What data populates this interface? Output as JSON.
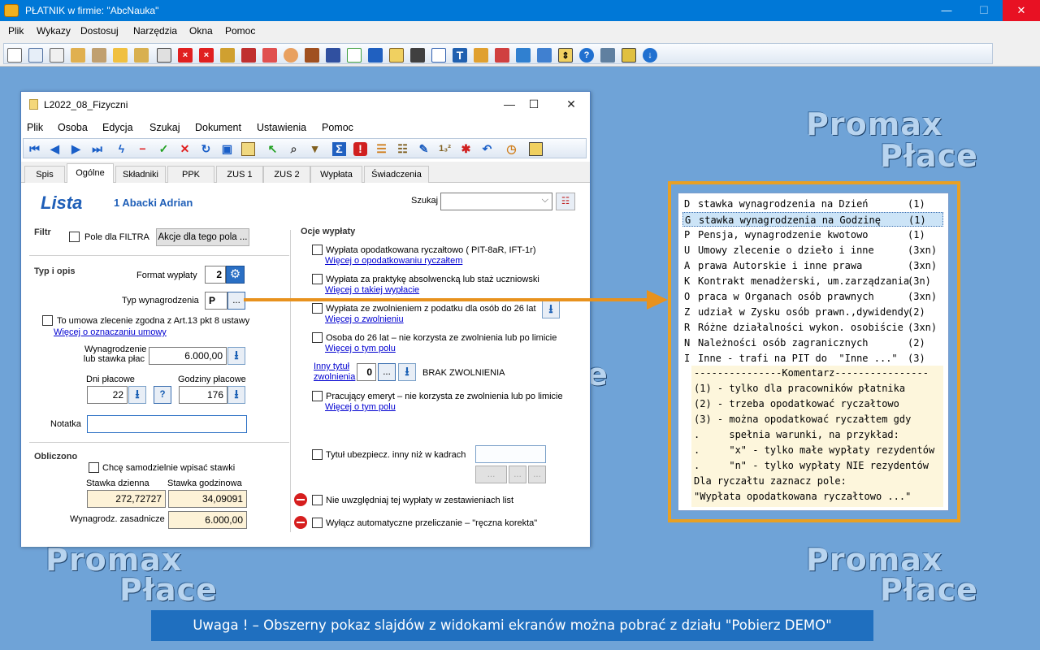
{
  "app": {
    "title": "PŁATNIK  w firmie:  \"AbcNauka\"",
    "menu": [
      "Plik",
      "Wykazy",
      "Dostosuj",
      "Narzędzia",
      "Okna",
      "Pomoc"
    ]
  },
  "watermark": {
    "line1": "Promax",
    "line2": "Płace",
    "partial": "e"
  },
  "child": {
    "title": "L2022_08_Fizyczni",
    "menu": [
      "Plik",
      "Osoba",
      "Edycja",
      "Szukaj",
      "Dokument",
      "Ustawienia",
      "Pomoc"
    ],
    "tabs": [
      "Spis",
      "Ogólne",
      "Składniki",
      "PPK",
      "ZUS 1",
      "ZUS 2",
      "Wypłata",
      "Świadczenia"
    ],
    "active_tab": "Ogólne"
  },
  "form": {
    "lista_label": "Lista",
    "employee": "1 Abacki Adrian",
    "szukaj_label": "Szukaj",
    "filtr_label": "Filtr",
    "pole_filtra_label": "Pole dla FILTRA",
    "akcje_button": "Akcje dla tego pola ...",
    "typ_i_opis_label": "Typ i opis",
    "format_wyplaty_label": "Format wypłaty",
    "format_wyplaty_value": "2",
    "typ_wynagrodzenia_label": "Typ wynagrodzenia",
    "typ_wynagrodzenia_value": "P",
    "ellipsis": "...",
    "umowa_label": "To umowa zlecenie zgodna z Art.13 pkt 8 ustawy",
    "umowa_link": "Więcej o oznaczaniu umowy",
    "wynagrodzenie_label_1": "Wynagrodzenie",
    "wynagrodzenie_label_2": "lub stawka płac",
    "wynagrodzenie_value": "6.000,00",
    "dni_label": "Dni płacowe",
    "dni_value": "22",
    "godziny_label": "Godziny płacowe",
    "godziny_value": "176",
    "help_glyph": "?",
    "notatka_label": "Notatka",
    "notatka_value": "",
    "obliczono_label": "Obliczono",
    "samodzielnie_label": "Chcę samodzielnie wpisać stawki",
    "stawka_dzienna_label": "Stawka dzienna",
    "stawka_dzienna_value": "272,72727",
    "stawka_godzinowa_label": "Stawka godzinowa",
    "stawka_godzinowa_value": "34,09091",
    "wynagrodz_zasadnicze_label": "Wynagrodz. zasadnicze",
    "wynagrodz_zasadnicze_value": "6.000,00",
    "opcje_label": "Ocje wypłaty",
    "opt1_label": "Wypłata opodatkowana ryczałtowo  ( PIT-8aR, IFT-1r)",
    "opt1_link": "Więcej o opodatkowaniu ryczałtem",
    "opt2_label": "Wypłata za praktykę absolwencką lub staż uczniowski",
    "opt2_link": "Więcej o takiej wypłacie",
    "opt3_label": "Wypłata ze zwolnieniem z podatku dla osób do 26 lat",
    "opt3_link": "Więcej o zwolnieniu",
    "opt4_label": "Osoba do 26 lat – nie korzysta ze zwolnienia lub po limicie",
    "opt4_link": "Więcej o tym polu",
    "inny_tytul_link_1": "Inny tytuł",
    "inny_tytul_link_2": "zwolnienia",
    "inny_tytul_value": "0",
    "brak_zwolnienia": "BRAK  ZWOLNIENIA",
    "opt5_label": "Pracujący emeryt – nie korzysta ze zwolnienia lub po limicie",
    "opt5_link": "Więcej o tym polu",
    "opt6_label": "Tytuł ubezpiecz. inny niż w kadrach",
    "opt7_label": "Nie uwzględniaj tej wypłaty w zestawieniach list",
    "opt8_label": "Wyłącz automatyczne przeliczanie  – \"ręczna korekta\""
  },
  "popup": {
    "items": [
      {
        "code": "D",
        "desc": "stawka wynagrodzenia na Dzień",
        "grp": "(1)"
      },
      {
        "code": "G",
        "desc": "stawka wynagrodzenia na Godzinę",
        "grp": "(1)"
      },
      {
        "code": "P",
        "desc": "Pensja, wynagrodzenie kwotowo",
        "grp": "(1)"
      },
      {
        "code": "U",
        "desc": "Umowy zlecenie o dzieło i inne",
        "grp": "(3xn)"
      },
      {
        "code": "A",
        "desc": "prawa Autorskie i inne prawa",
        "grp": "(3xn)"
      },
      {
        "code": "K",
        "desc": "Kontrakt menadżerski, um.zarządzania",
        "grp": "(3n)"
      },
      {
        "code": "O",
        "desc": "praca w Organach osób prawnych",
        "grp": "(3xn)"
      },
      {
        "code": "Z",
        "desc": "udział w Zysku osób prawn.,dywidendy",
        "grp": "(2)"
      },
      {
        "code": "R",
        "desc": "Różne działalności wykon. osobiście",
        "grp": "(3xn)"
      },
      {
        "code": "N",
        "desc": "Należności osób zagranicznych",
        "grp": "(2)"
      },
      {
        "code": "I",
        "desc": "Inne - trafi na PIT do  \"Inne ...\"",
        "grp": "(3)"
      }
    ],
    "selected_index": 1,
    "comment": [
      "---------------Komentarz----------------",
      "(1) - tylko dla pracowników płatnika",
      "(2) - trzeba opodatkować ryczałtowo",
      "(3) - można opodatkować ryczałtem gdy",
      ".     spełnia warunki, na przykład:",
      ".     \"x\" - tylko małe wypłaty rezydentów",
      ".     \"n\" - tylko wypłaty NIE rezydentów",
      "Dla ryczałtu zaznacz pole:",
      "\"Wypłata opodatkowana ryczałtowo ...\""
    ]
  },
  "banner": "Uwaga ! – Obszerny pokaz slajdów z widokami ekranów można pobrać z działu \"Pobierz DEMO\"",
  "colors": {
    "accent": "#e8921e",
    "titlebar": "#0078d7",
    "desktop": "#6fa3d7",
    "link": "#0000d0",
    "readonly": "#fdf2d7"
  }
}
